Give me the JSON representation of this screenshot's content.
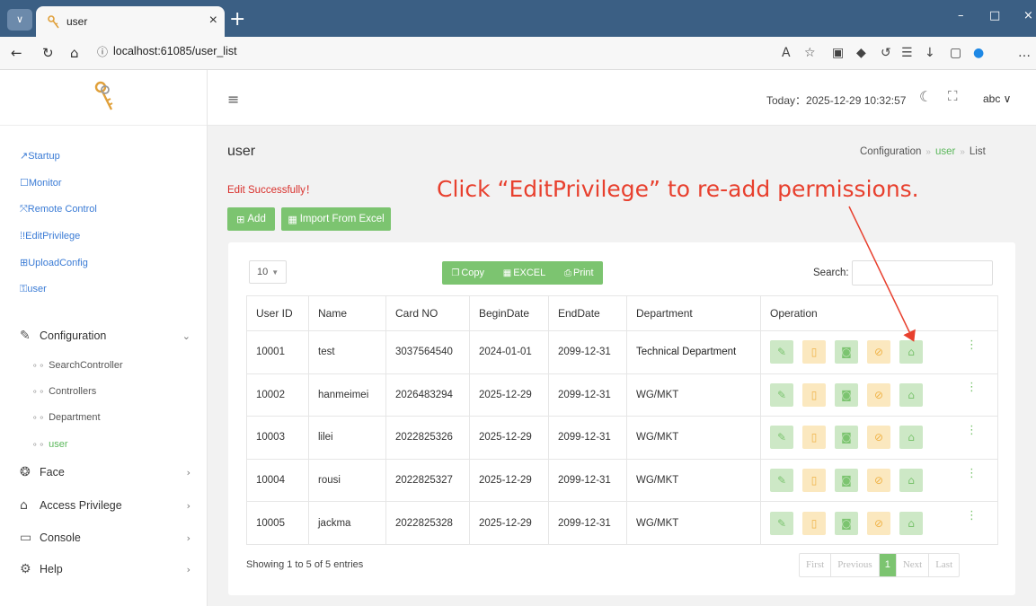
{
  "browser": {
    "tab_title": "user",
    "url": "localhost:61085/user_list",
    "new_tab": "+",
    "win_min": "–",
    "win_max": "□",
    "win_close": "×"
  },
  "sidebar": {
    "quick_links": [
      "↗Startup",
      "☐Monitor",
      "⤧Remote Control",
      "⁞!EditPrivilege",
      "⊞UploadConfig",
      "⚿user"
    ],
    "groups": [
      {
        "label": "Configuration",
        "icon": "edit-icon"
      },
      {
        "label": "Face",
        "icon": "face-icon"
      },
      {
        "label": "Access Privilege",
        "icon": "home-icon"
      },
      {
        "label": "Console",
        "icon": "console-icon"
      },
      {
        "label": "Help",
        "icon": "gear-icon"
      }
    ],
    "config_items": [
      "SearchController",
      "Controllers",
      "Department",
      "user"
    ]
  },
  "header": {
    "today": "Today：2025-12-29 10:32:57",
    "user": "abc ∨"
  },
  "page": {
    "title": "user",
    "breadcrumb": [
      "Configuration",
      "user",
      "List"
    ],
    "edit_message": "Edit Successfully！",
    "annotation": "Click “EditPrivilege” to re-add permissions.",
    "add_label": "Add",
    "import_label": "Import From Excel"
  },
  "table_tools": {
    "page_size": "10",
    "copy_label": "Copy",
    "excel_label": "EXCEL",
    "print_label": "Print",
    "search_label": "Search:"
  },
  "table": {
    "columns": [
      "User ID",
      "Name",
      "Card NO",
      "BeginDate",
      "EndDate",
      "Department",
      "Operation"
    ],
    "rows": [
      [
        "10001",
        "test",
        "3037564540",
        "2024-01-01",
        "2099-12-31",
        "Technical Department"
      ],
      [
        "10002",
        "hanmeimei",
        "2026483294",
        "2025-12-29",
        "2099-12-31",
        "WG/MKT"
      ],
      [
        "10003",
        "lilei",
        "2022825326",
        "2025-12-29",
        "2099-12-31",
        "WG/MKT"
      ],
      [
        "10004",
        "rousi",
        "2022825327",
        "2025-12-29",
        "2099-12-31",
        "WG/MKT"
      ],
      [
        "10005",
        "jackma",
        "2022825328",
        "2025-12-29",
        "2099-12-31",
        "WG/MKT"
      ]
    ],
    "operation_icons": [
      "edit-icon",
      "delete-icon",
      "camera-icon",
      "disable-icon",
      "lock-icon"
    ]
  },
  "footer": {
    "showing": "Showing 1 to 5 of 5 entries",
    "pager": [
      "First",
      "Previous",
      "1",
      "Next",
      "Last"
    ]
  },
  "colors": {
    "accent": "#7cc470",
    "danger": "#d9302c",
    "annotation": "#e8402e",
    "titlebar": "#3b5f84"
  }
}
